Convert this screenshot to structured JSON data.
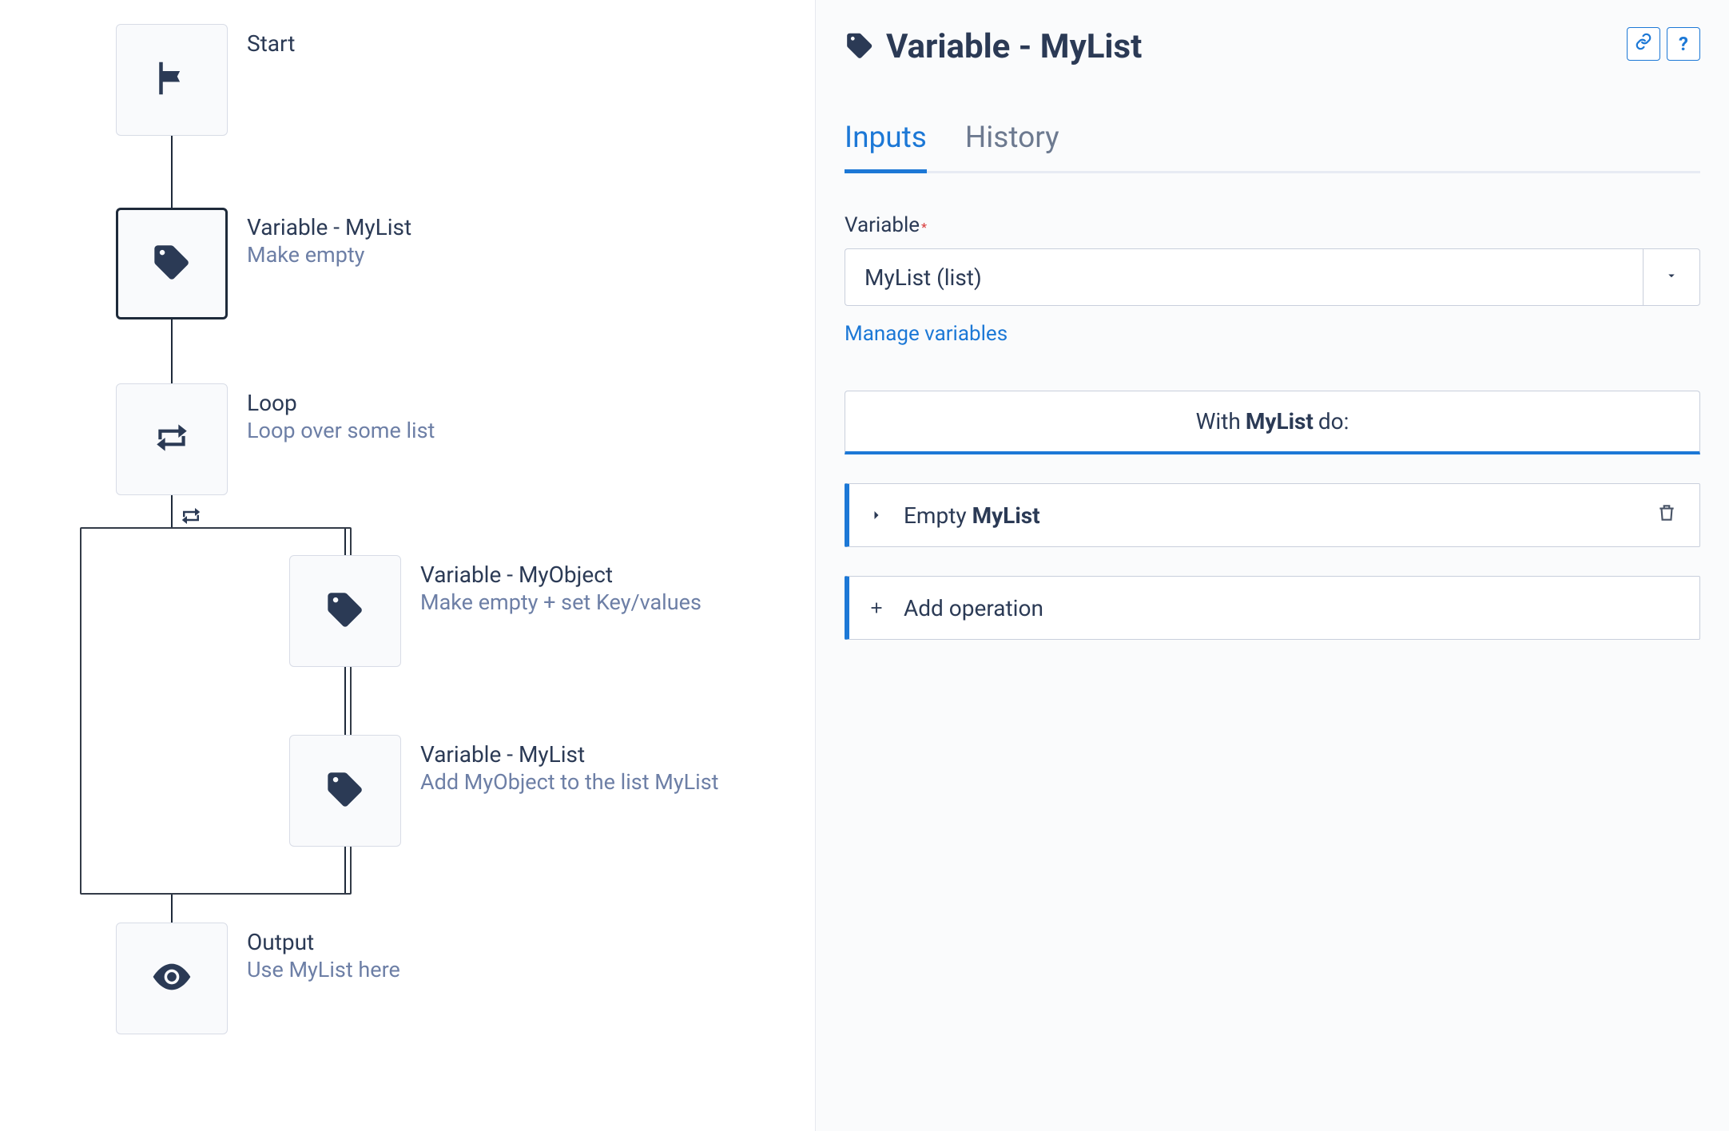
{
  "flow": {
    "nodes": {
      "start": {
        "title": "Start"
      },
      "var1": {
        "title": "Variable - MyList",
        "subtitle": "Make empty"
      },
      "loop": {
        "title": "Loop",
        "subtitle": "Loop over some list"
      },
      "var2": {
        "title": "Variable - MyObject",
        "subtitle": "Make empty + set Key/values"
      },
      "var3": {
        "title": "Variable - MyList",
        "subtitle": "Add MyObject to the list MyList"
      },
      "output": {
        "title": "Output",
        "subtitle": "Use MyList here"
      }
    }
  },
  "panel": {
    "title": "Variable - MyList",
    "tabs": {
      "inputs": "Inputs",
      "history": "History"
    },
    "field_label": "Variable",
    "select_value": "MyList (list)",
    "manage_link": "Manage variables",
    "with_prefix": "With",
    "with_var": "MyList",
    "with_suffix": "do:",
    "op_empty_prefix": "Empty",
    "op_empty_var": "MyList",
    "add_op_label": "Add operation",
    "help_char": "?"
  }
}
